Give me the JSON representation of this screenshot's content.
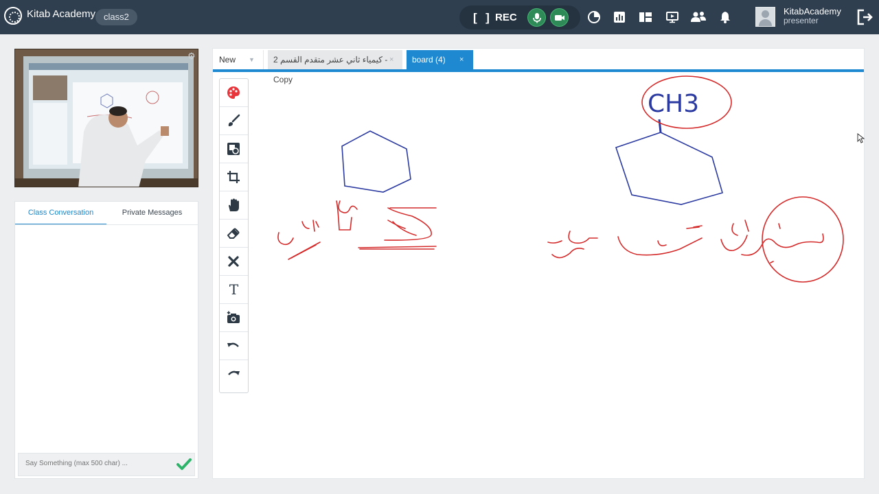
{
  "app": {
    "brand": "Kitab Academy",
    "class_name": "class2"
  },
  "recording": {
    "label": "REC",
    "bracket": "[ ]"
  },
  "user": {
    "name": "KitabAcademy",
    "role": "presenter"
  },
  "chat": {
    "tabs": [
      "Class Conversation",
      "Private Messages"
    ],
    "active_tab": 0,
    "input_placeholder": "Say Something (max 500 char) ..."
  },
  "board": {
    "new_label": "New",
    "tabs": [
      {
        "label": "كيمياء ثاني عشر متقدم القسم 2 - Copy",
        "close": "×"
      },
      {
        "label": "board (4)",
        "close": "×",
        "active": true
      }
    ],
    "drawing_text": {
      "ch3": "CH3"
    }
  },
  "toolbar": {
    "tools": [
      "palette-icon",
      "brush-icon",
      "shapes-icon",
      "crop-icon",
      "hand-icon",
      "eraser-icon",
      "clear-icon",
      "text-icon",
      "camera-add-icon",
      "undo-icon",
      "redo-icon"
    ],
    "text_glyph": "T"
  },
  "colors": {
    "topbar": "#2f3f4f",
    "accent": "#1e88d0",
    "ink_blue": "#2b3aa0",
    "ink_red": "#d42a2a",
    "green": "#2eb36a"
  }
}
